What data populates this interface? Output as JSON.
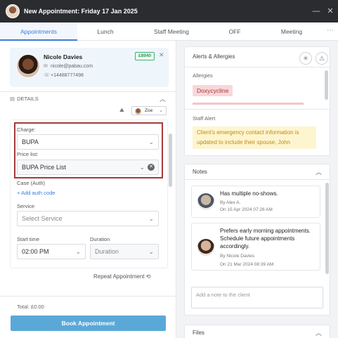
{
  "window": {
    "title": "New Appointment: Friday 17 Jan 2025"
  },
  "tabs": [
    {
      "label": "Appointments"
    },
    {
      "label": "Lunch"
    },
    {
      "label": "Staff Meeting"
    },
    {
      "label": "OFF"
    },
    {
      "label": "Meeting"
    }
  ],
  "client": {
    "name": "Nicole Davies",
    "email": "nicole@pabau.com",
    "phone": "+14488777498",
    "badge": "£8940"
  },
  "details": {
    "header": "DETAILS",
    "staff": "Zoe",
    "charge_label": "Charge:",
    "charge_value": "BUPA",
    "pricelist_label": "Price list:",
    "pricelist_value": "BUPA Price List",
    "case_label": "Case (Auth)",
    "add_auth": "Add auth code",
    "service_label": "Service",
    "service_placeholder": "Select Service",
    "start_time_label": "Start time",
    "start_time_value": "02:00 PM",
    "duration_label": "Duration",
    "duration_placeholder": "Duration",
    "repeat": "Repeat Appointment"
  },
  "footer": {
    "total": "Total: £0.00",
    "book": "Book Appointment"
  },
  "alerts": {
    "title": "Alerts & Allergies",
    "allergies_label": "Allergies",
    "allergy": "Doxycycline",
    "staff_alert_label": "Staff Alert",
    "staff_alert": "Client's emergency contact information is updated to include their spouse, John"
  },
  "notes": {
    "title": "Notes",
    "items": [
      {
        "text": "Has multiple no-shows.",
        "by": "By Alex A.",
        "date": "On 15 Apr 2024 07:26 AM"
      },
      {
        "text": "Prefers early morning appointments. Schedule future appointments accordingly.",
        "by": "By Nicole Davies",
        "date": "On 21 Mar 2024 08:39 AM"
      }
    ],
    "input_placeholder": "Add a note to the client"
  },
  "files": {
    "title": "Files"
  },
  "colors": {
    "accent": "#3b7dd8",
    "book_button": "#5aa8d8",
    "highlight": "#a53a37",
    "badge": "#2f9a59",
    "allergy_bg": "#f8d7da",
    "staff_alert_bg": "#fdf5cf"
  }
}
